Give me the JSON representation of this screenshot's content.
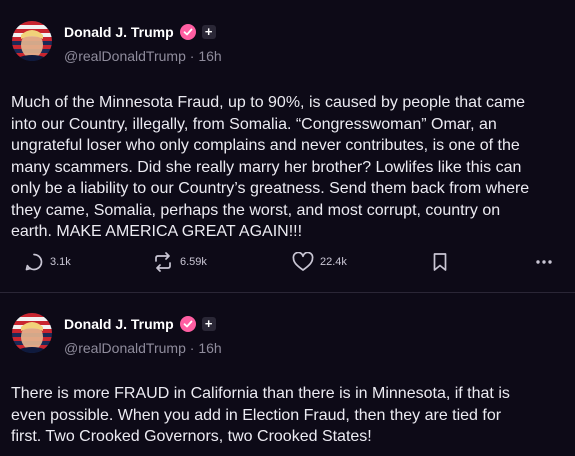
{
  "posts": [
    {
      "author": {
        "name": "Donald J. Trump",
        "handle": "@realDonaldTrump",
        "time": "16h"
      },
      "text": "Much of the Minnesota Fraud, up to 90%, is caused by people that came\ninto our Country, illegally, from Somalia. “Congresswoman” Omar, an\nungrateful loser who only complains and never contributes, is one of the\nmany scammers. Did she really marry her brother? Lowlifes like this can\nonly be a liability to our Country’s greatness. Send them back from where\nthey came, Somalia, perhaps the worst, and most corrupt, country on\nearth. MAKE AMERICA GREAT AGAIN!!!",
      "counts": {
        "replies": "3.1k",
        "reposts": "6.59k",
        "likes": "22.4k"
      }
    },
    {
      "author": {
        "name": "Donald J. Trump",
        "handle": "@realDonaldTrump",
        "time": "16h"
      },
      "text": "There is more FRAUD in California than there is in Minnesota, if that is\neven possible. When you add in Election Fraud, then they are tied for\nfirst. Two Crooked Governors, two Crooked States!"
    }
  ],
  "separator": "·",
  "plus_label": "+",
  "colors": {
    "background": "#0d0a17",
    "verified": "#ff5ea2",
    "muted": "#8f8c9c"
  },
  "icons": [
    "reply-icon",
    "repost-icon",
    "like-icon",
    "bookmark-icon",
    "more-icon",
    "verified-icon"
  ]
}
